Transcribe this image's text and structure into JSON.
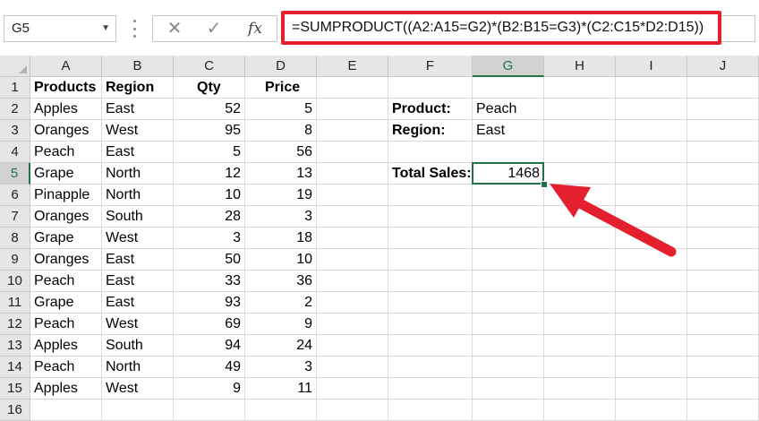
{
  "name_box": "G5",
  "formula_bar": {
    "cancel_icon": "x-icon",
    "enter_icon": "check-icon",
    "fx_label": "fx",
    "formula": "=SUMPRODUCT((A2:A15=G2)*(B2:B15=G3)*(C2:C15*D2:D15))"
  },
  "columns": [
    "A",
    "B",
    "C",
    "D",
    "E",
    "F",
    "G",
    "H",
    "I",
    "J"
  ],
  "rows": [
    "1",
    "2",
    "3",
    "4",
    "5",
    "6",
    "7",
    "8",
    "9",
    "10",
    "11",
    "12",
    "13",
    "14",
    "15",
    "16"
  ],
  "headers": {
    "products": "Products",
    "region": "Region",
    "qty": "Qty",
    "price": "Price"
  },
  "table": [
    [
      "Apples",
      "East",
      "52",
      "5"
    ],
    [
      "Oranges",
      "West",
      "95",
      "8"
    ],
    [
      "Peach",
      "East",
      "5",
      "56"
    ],
    [
      "Grape",
      "North",
      "12",
      "13"
    ],
    [
      "Pinapple",
      "North",
      "10",
      "19"
    ],
    [
      "Oranges",
      "South",
      "28",
      "3"
    ],
    [
      "Grape",
      "West",
      "3",
      "18"
    ],
    [
      "Oranges",
      "East",
      "50",
      "10"
    ],
    [
      "Peach",
      "East",
      "33",
      "36"
    ],
    [
      "Grape",
      "East",
      "93",
      "2"
    ],
    [
      "Peach",
      "West",
      "69",
      "9"
    ],
    [
      "Apples",
      "South",
      "94",
      "24"
    ],
    [
      "Peach",
      "North",
      "49",
      "3"
    ],
    [
      "Apples",
      "West",
      "9",
      "11"
    ]
  ],
  "criteria": {
    "product_label": "Product:",
    "product_value": "Peach",
    "region_label": "Region:",
    "region_value": "East",
    "total_label": "Total Sales:",
    "total_value": "1468"
  },
  "colors": {
    "highlight_border": "#e5202e",
    "selection": "#217346",
    "arrow": "#e5202e"
  }
}
